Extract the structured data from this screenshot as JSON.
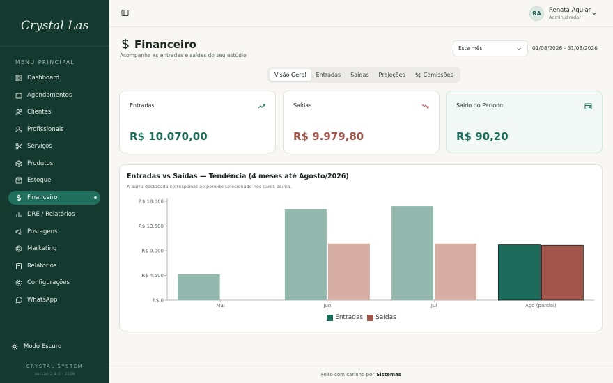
{
  "sidebar": {
    "logo_text": "Crystal Lashes",
    "menu_title": "MENU PRINCIPAL",
    "items": [
      {
        "label": "Dashboard",
        "icon": "grid-icon"
      },
      {
        "label": "Agendamentos",
        "icon": "calendar-icon"
      },
      {
        "label": "Clientes",
        "icon": "users-icon"
      },
      {
        "label": "Profissionais",
        "icon": "user-gear-icon"
      },
      {
        "label": "Serviços",
        "icon": "scissors-icon"
      },
      {
        "label": "Produtos",
        "icon": "package-icon"
      },
      {
        "label": "Estoque",
        "icon": "box-icon"
      },
      {
        "label": "Financeiro",
        "icon": "dollar-icon",
        "active": true
      },
      {
        "label": "DRE / Relatórios",
        "icon": "bar-chart-icon"
      },
      {
        "label": "Postagens",
        "icon": "megaphone-icon"
      },
      {
        "label": "Marketing",
        "icon": "target-icon"
      },
      {
        "label": "Relatórios",
        "icon": "clipboard-icon"
      },
      {
        "label": "Configurações",
        "icon": "gear-icon"
      },
      {
        "label": "WhatsApp",
        "icon": "whatsapp-icon"
      }
    ],
    "dark_mode_label": "Modo Escuro",
    "system_name": "CRYSTAL SYSTEM",
    "version": "Versão 2.4.0 · 2026"
  },
  "topbar": {
    "user_initials": "RA",
    "user_name": "Renata Aguiar",
    "user_role": "Administrador"
  },
  "page": {
    "title": "Financeiro",
    "subtitle": "Acompanhe as entradas e saídas do seu estúdio",
    "period_selected": "Este mês",
    "date_range": "01/08/2026 - 31/08/2026"
  },
  "tabs": [
    {
      "label": "Visão Geral",
      "active": true
    },
    {
      "label": "Entradas"
    },
    {
      "label": "Saídas"
    },
    {
      "label": "Projeções"
    },
    {
      "label": "Comissões",
      "icon": "percent-icon"
    }
  ],
  "cards": {
    "entradas": {
      "label": "Entradas",
      "value": "R$ 10.070,00",
      "icon": "trend-up-icon"
    },
    "saidas": {
      "label": "Saídas",
      "value": "R$ 9.979,80",
      "icon": "trend-down-icon"
    },
    "saldo": {
      "label": "Saldo do Período",
      "value": "R$ 90,20",
      "icon": "wallet-icon"
    }
  },
  "colors": {
    "brand_dark": "#143a2f",
    "entradas_light": "#93b8ae",
    "saidas_light": "#d7aea4",
    "entradas_strong": "#1d6c5b",
    "saidas_strong": "#a2554a",
    "positive": "#1d6c5b",
    "negative": "#a2554a"
  },
  "chart_data": {
    "type": "bar",
    "title": "Entradas vs Saídas — Tendência (4 meses até Agosto/2026)",
    "subtitle": "A barra destacada corresponde ao período selecionado nos cards acima.",
    "categories": [
      "Mai",
      "Jun",
      "Jul",
      "Ago (parcial)"
    ],
    "series": [
      {
        "name": "Entradas",
        "values": [
          4700,
          16600,
          17100,
          10070
        ]
      },
      {
        "name": "Saídas",
        "values": [
          0,
          10300,
          10300,
          9979.8
        ]
      }
    ],
    "highlight_category": "Ago (parcial)",
    "y_ticks": [
      "R$ 0",
      "R$ 4.500",
      "R$ 9.000",
      "R$ 13.500",
      "R$ 18.000"
    ],
    "ylim": [
      0,
      18000
    ],
    "legend_position": "bottom-center"
  },
  "footer": {
    "text": "Feito com carinho por",
    "brand": "Sistemas"
  }
}
